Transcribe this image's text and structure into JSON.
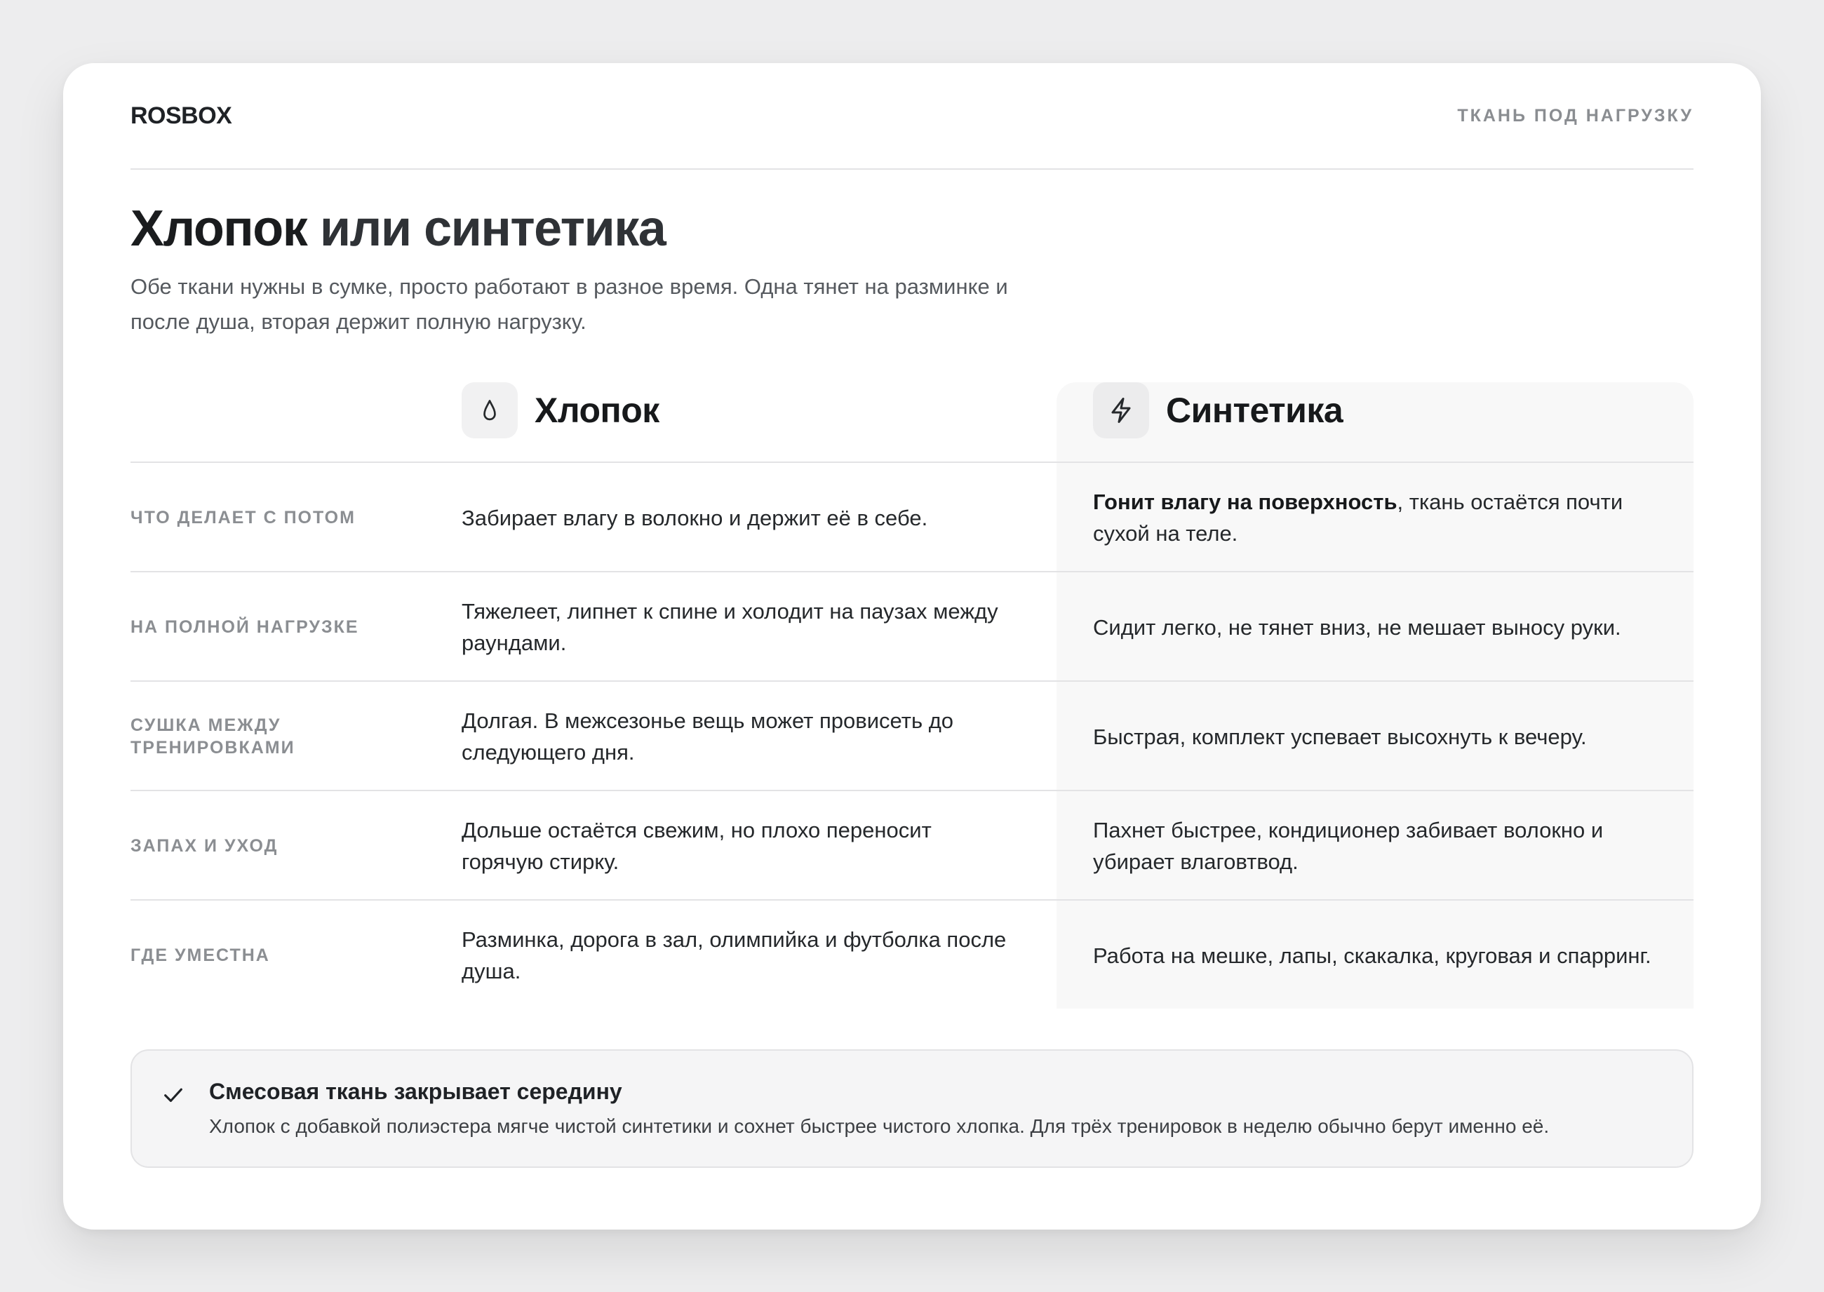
{
  "header": {
    "brand": "ROSBOX",
    "tagline": "ТКАНЬ ПОД НАГРУЗКУ"
  },
  "hero": {
    "title_main": "Хлопок",
    "title_rest": "или синтетика",
    "subtitle": "Обе ткани нужны в сумке, просто работают в разное время. Одна тянет на разминке и после душа, вторая держит полную нагрузку."
  },
  "comparison": {
    "columns": {
      "cotton": {
        "label": "Хлопок",
        "icon": "droplet-icon"
      },
      "synthetic": {
        "label": "Синтетика",
        "icon": "lightning-icon"
      }
    },
    "rows": [
      {
        "label": "ЧТО ДЕЛАЕТ С ПОТОМ",
        "cotton": "Забирает влагу в волокно и держит её в себе.",
        "synthetic_bold": "Гонит влагу на поверхность",
        "synthetic": ", ткань остаётся почти сухой на теле."
      },
      {
        "label": "НА ПОЛНОЙ НАГРУЗКЕ",
        "cotton": "Тяжелеет, липнет к спине и холодит на паузах между раундами.",
        "synthetic_bold": "",
        "synthetic": "Сидит легко, не тянет вниз, не мешает выносу руки."
      },
      {
        "label": "СУШКА МЕЖДУ ТРЕНИРОВКАМИ",
        "cotton": "Долгая. В межсезонье вещь может провисеть до следующего дня.",
        "synthetic_bold": "",
        "synthetic": "Быстрая, комплект успевает высохнуть к вечеру."
      },
      {
        "label": "ЗАПАХ И УХОД",
        "cotton": "Дольше остаётся свежим, но плохо переносит горячую стирку.",
        "synthetic_bold": "",
        "synthetic": "Пахнет быстрее, кондиционер забивает волокно и убирает влаговтвод."
      },
      {
        "label": "ГДЕ УМЕСТНА",
        "cotton": "Разминка, дорога в зал, олимпийка и футболка после душа.",
        "synthetic_bold": "",
        "synthetic": "Работа на мешке, лапы, скакалка, круговая и спарринг."
      }
    ]
  },
  "note": {
    "icon": "checkmark-icon",
    "title": "Смесовая ткань закрывает середину",
    "text": "Хлопок с добавкой полиэстера мягче чистой синтетики и сохнет быстрее чистого хлопка. Для трёх тренировок в неделю обычно берут именно её."
  }
}
